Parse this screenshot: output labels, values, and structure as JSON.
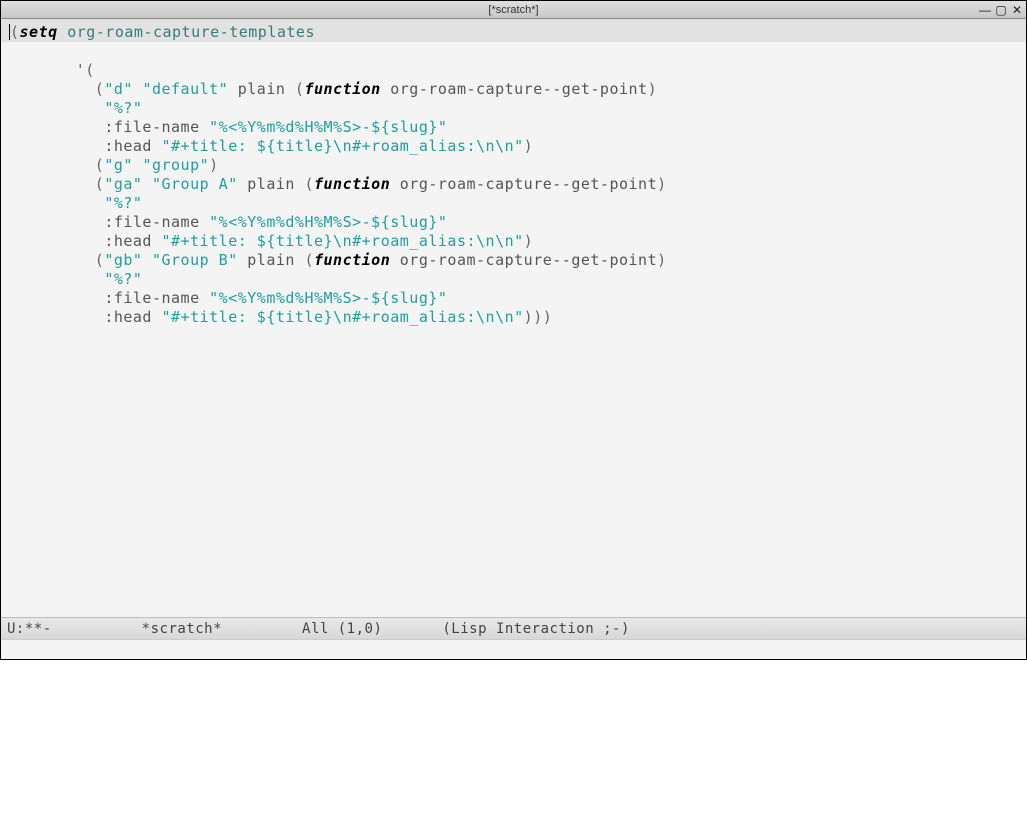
{
  "window": {
    "title": "[*scratch*]"
  },
  "code": {
    "line1": {
      "p1": "(",
      "setq": "setq",
      "sp": " ",
      "var": "org-roam-capture-templates"
    },
    "line2": "       '(",
    "line3": {
      "indent": "         (",
      "s1": "\"d\"",
      "sp1": " ",
      "s2": "\"default\"",
      "sp2": " ",
      "plain": "plain",
      "sp3": " (",
      "fn": "function",
      "sp4": " ",
      "fnname": "org-roam-capture--get-point",
      "close": ")"
    },
    "line4": {
      "indent": "          ",
      "s": "\"%?\""
    },
    "line5": {
      "indent": "          ",
      "key": ":file-name",
      "sp": " ",
      "val": "\"%<%Y%m%d%H%M%S>-${slug}\""
    },
    "line6": {
      "indent": "          ",
      "key": ":head",
      "sp": " ",
      "val": "\"#+title: ${title}\\n#+roam_alias:\\n\\n\"",
      "close": ")"
    },
    "line7": {
      "indent": "         (",
      "s1": "\"g\"",
      "sp": " ",
      "s2": "\"group\"",
      "close": ")"
    },
    "line8": {
      "indent": "         (",
      "s1": "\"ga\"",
      "sp1": " ",
      "s2": "\"Group A\"",
      "sp2": " ",
      "plain": "plain",
      "sp3": " (",
      "fn": "function",
      "sp4": " ",
      "fnname": "org-roam-capture--get-point",
      "close": ")"
    },
    "line9": {
      "indent": "          ",
      "s": "\"%?\""
    },
    "line10": {
      "indent": "          ",
      "key": ":file-name",
      "sp": " ",
      "val": "\"%<%Y%m%d%H%M%S>-${slug}\""
    },
    "line11": {
      "indent": "          ",
      "key": ":head",
      "sp": " ",
      "val": "\"#+title: ${title}\\n#+roam_alias:\\n\\n\"",
      "close": ")"
    },
    "line12": {
      "indent": "         (",
      "s1": "\"gb\"",
      "sp1": " ",
      "s2": "\"Group B\"",
      "sp2": " ",
      "plain": "plain",
      "sp3": " (",
      "fn": "function",
      "sp4": " ",
      "fnname": "org-roam-capture--get-point",
      "close": ")"
    },
    "line13": {
      "indent": "          ",
      "s": "\"%?\""
    },
    "line14": {
      "indent": "          ",
      "key": ":file-name",
      "sp": " ",
      "val": "\"%<%Y%m%d%H%M%S>-${slug}\""
    },
    "line15": {
      "indent": "          ",
      "key": ":head",
      "sp": " ",
      "val": "\"#+title: ${title}\\n#+roam_alias:\\n\\n\"",
      "close": ")))"
    }
  },
  "modeline": {
    "status": "U:**-",
    "buffer": "*scratch*",
    "position": "All (1,0)",
    "mode": "(Lisp Interaction ;-)"
  }
}
